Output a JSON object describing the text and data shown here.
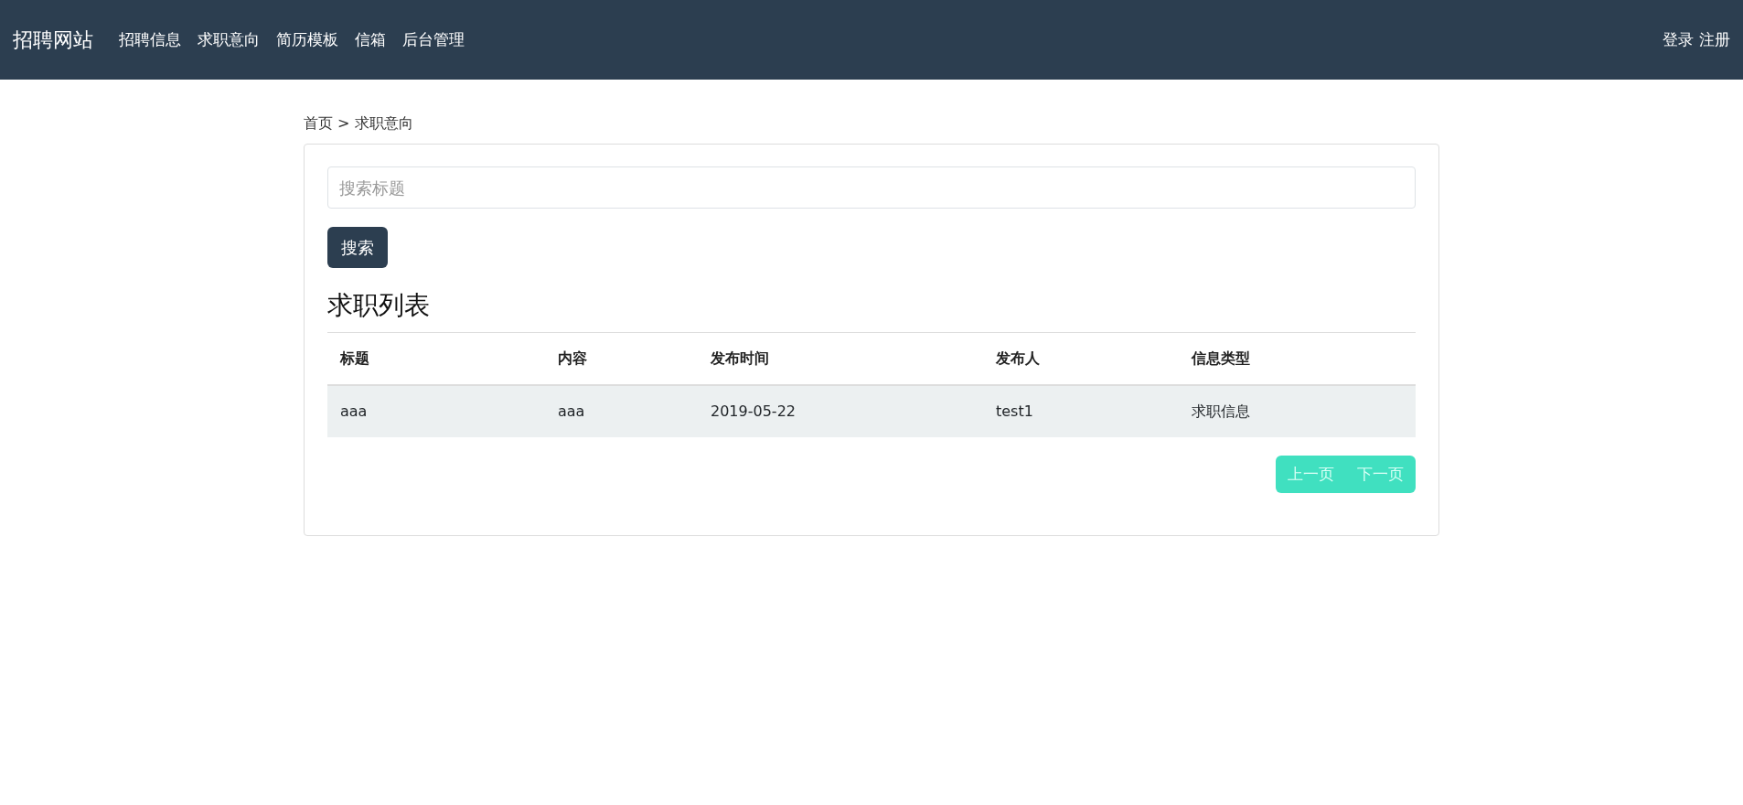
{
  "navbar": {
    "brand": "招聘网站",
    "links": [
      {
        "label": "招聘信息"
      },
      {
        "label": "求职意向"
      },
      {
        "label": "简历模板"
      },
      {
        "label": "信箱"
      },
      {
        "label": "后台管理"
      }
    ],
    "right_links": [
      {
        "label": "登录"
      },
      {
        "label": "注册"
      }
    ]
  },
  "breadcrumb": "首页 > 求职意向",
  "search": {
    "placeholder": "搜索标题",
    "button": "搜索"
  },
  "list_title": "求职列表",
  "table": {
    "columns": [
      "标题",
      "内容",
      "发布时间",
      "发布人",
      "信息类型"
    ],
    "rows": [
      [
        "aaa",
        "aaa",
        "2019-05-22",
        "test1",
        "求职信息"
      ]
    ]
  },
  "pagination": [
    "上一页",
    "下一页"
  ]
}
